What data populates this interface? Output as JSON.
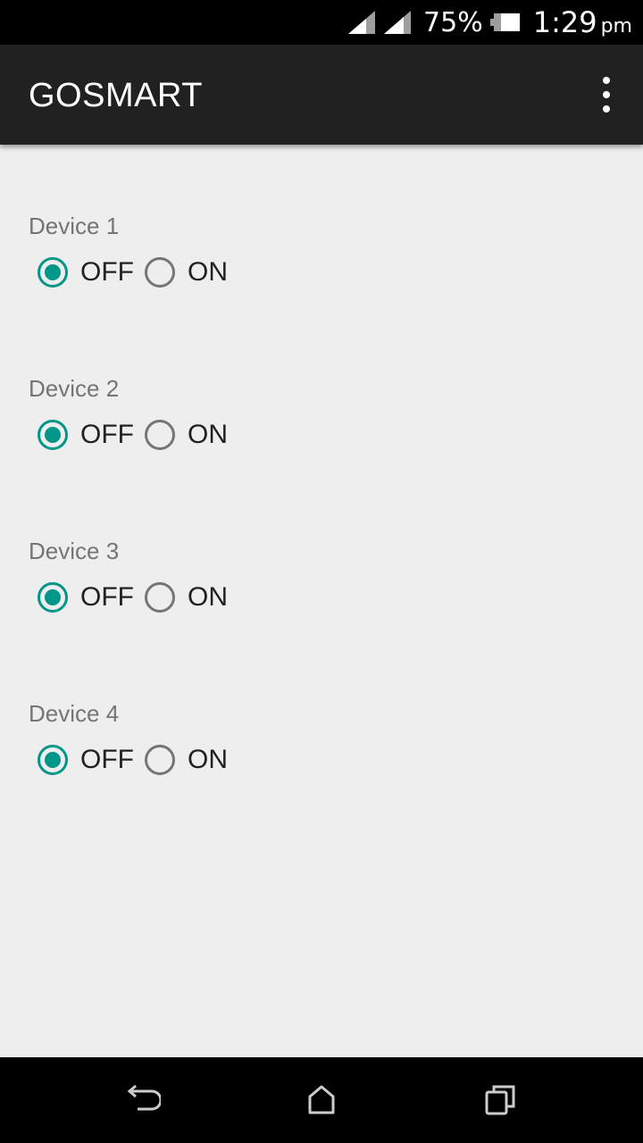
{
  "status_bar": {
    "battery_percent": "75%",
    "time": "1:29",
    "ampm": "pm",
    "icons": [
      "signal-icon",
      "signal-icon",
      "battery-icon"
    ]
  },
  "app_bar": {
    "title": "GOSMART",
    "menu_icon": "overflow-menu-icon"
  },
  "devices": [
    {
      "label": "Device 1",
      "off_label": "OFF",
      "on_label": "ON",
      "selected": "OFF"
    },
    {
      "label": "Device 2",
      "off_label": "OFF",
      "on_label": "ON",
      "selected": "OFF"
    },
    {
      "label": "Device 3",
      "off_label": "OFF",
      "on_label": "ON",
      "selected": "OFF"
    },
    {
      "label": "Device 4",
      "off_label": "OFF",
      "on_label": "ON",
      "selected": "OFF"
    }
  ],
  "nav_bar": {
    "icons": [
      "back-icon",
      "home-icon",
      "recents-icon"
    ]
  },
  "colors": {
    "accent": "#009688",
    "app_bar": "#212121",
    "background": "#eeeeee"
  }
}
